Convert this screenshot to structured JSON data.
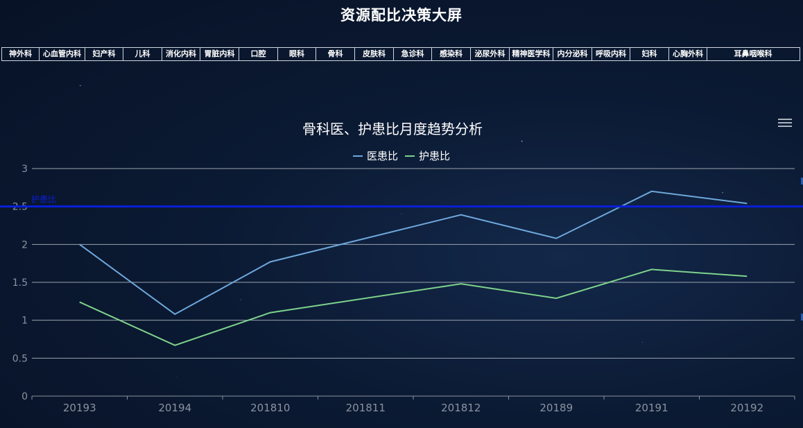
{
  "page": {
    "title": "资源配比决策大屏"
  },
  "departments": [
    "神外科",
    "心血管内科",
    "妇产科",
    "儿科",
    "消化内科",
    "胃脏内科",
    "口腔",
    "眼科",
    "骨科",
    "皮肤科",
    "急诊科",
    "感染科",
    "泌尿外科",
    "精神医学科",
    "内分泌科",
    "呼吸内科",
    "妇科",
    "心胸外科",
    "耳鼻咽喉科"
  ],
  "icons": {
    "menu": "hamburger-menu-icon"
  },
  "colors": {
    "doctor_ratio": "#6fa8dc",
    "nurse_ratio": "#7ed38c",
    "reference_line": "#0a1fd8"
  },
  "chart_data": {
    "type": "line",
    "title": "骨科医、护患比月度趋势分析",
    "categories": [
      "20193",
      "20194",
      "201810",
      "201811",
      "201812",
      "20189",
      "20191",
      "20192"
    ],
    "series": [
      {
        "name": "医患比",
        "values": [
          2.0,
          1.08,
          1.77,
          null,
          2.39,
          2.08,
          2.7,
          2.54
        ]
      },
      {
        "name": "护患比",
        "values": [
          1.24,
          0.67,
          1.1,
          null,
          1.48,
          1.29,
          1.67,
          1.58
        ]
      }
    ],
    "y_ticks": [
      "0",
      "0.5",
      "1",
      "1.5",
      "2",
      "2.5",
      "3"
    ],
    "ylim": [
      0,
      3
    ],
    "markline": {
      "value": 2.5,
      "label": "护患比"
    },
    "legend_position": "top-center",
    "grid": true
  }
}
